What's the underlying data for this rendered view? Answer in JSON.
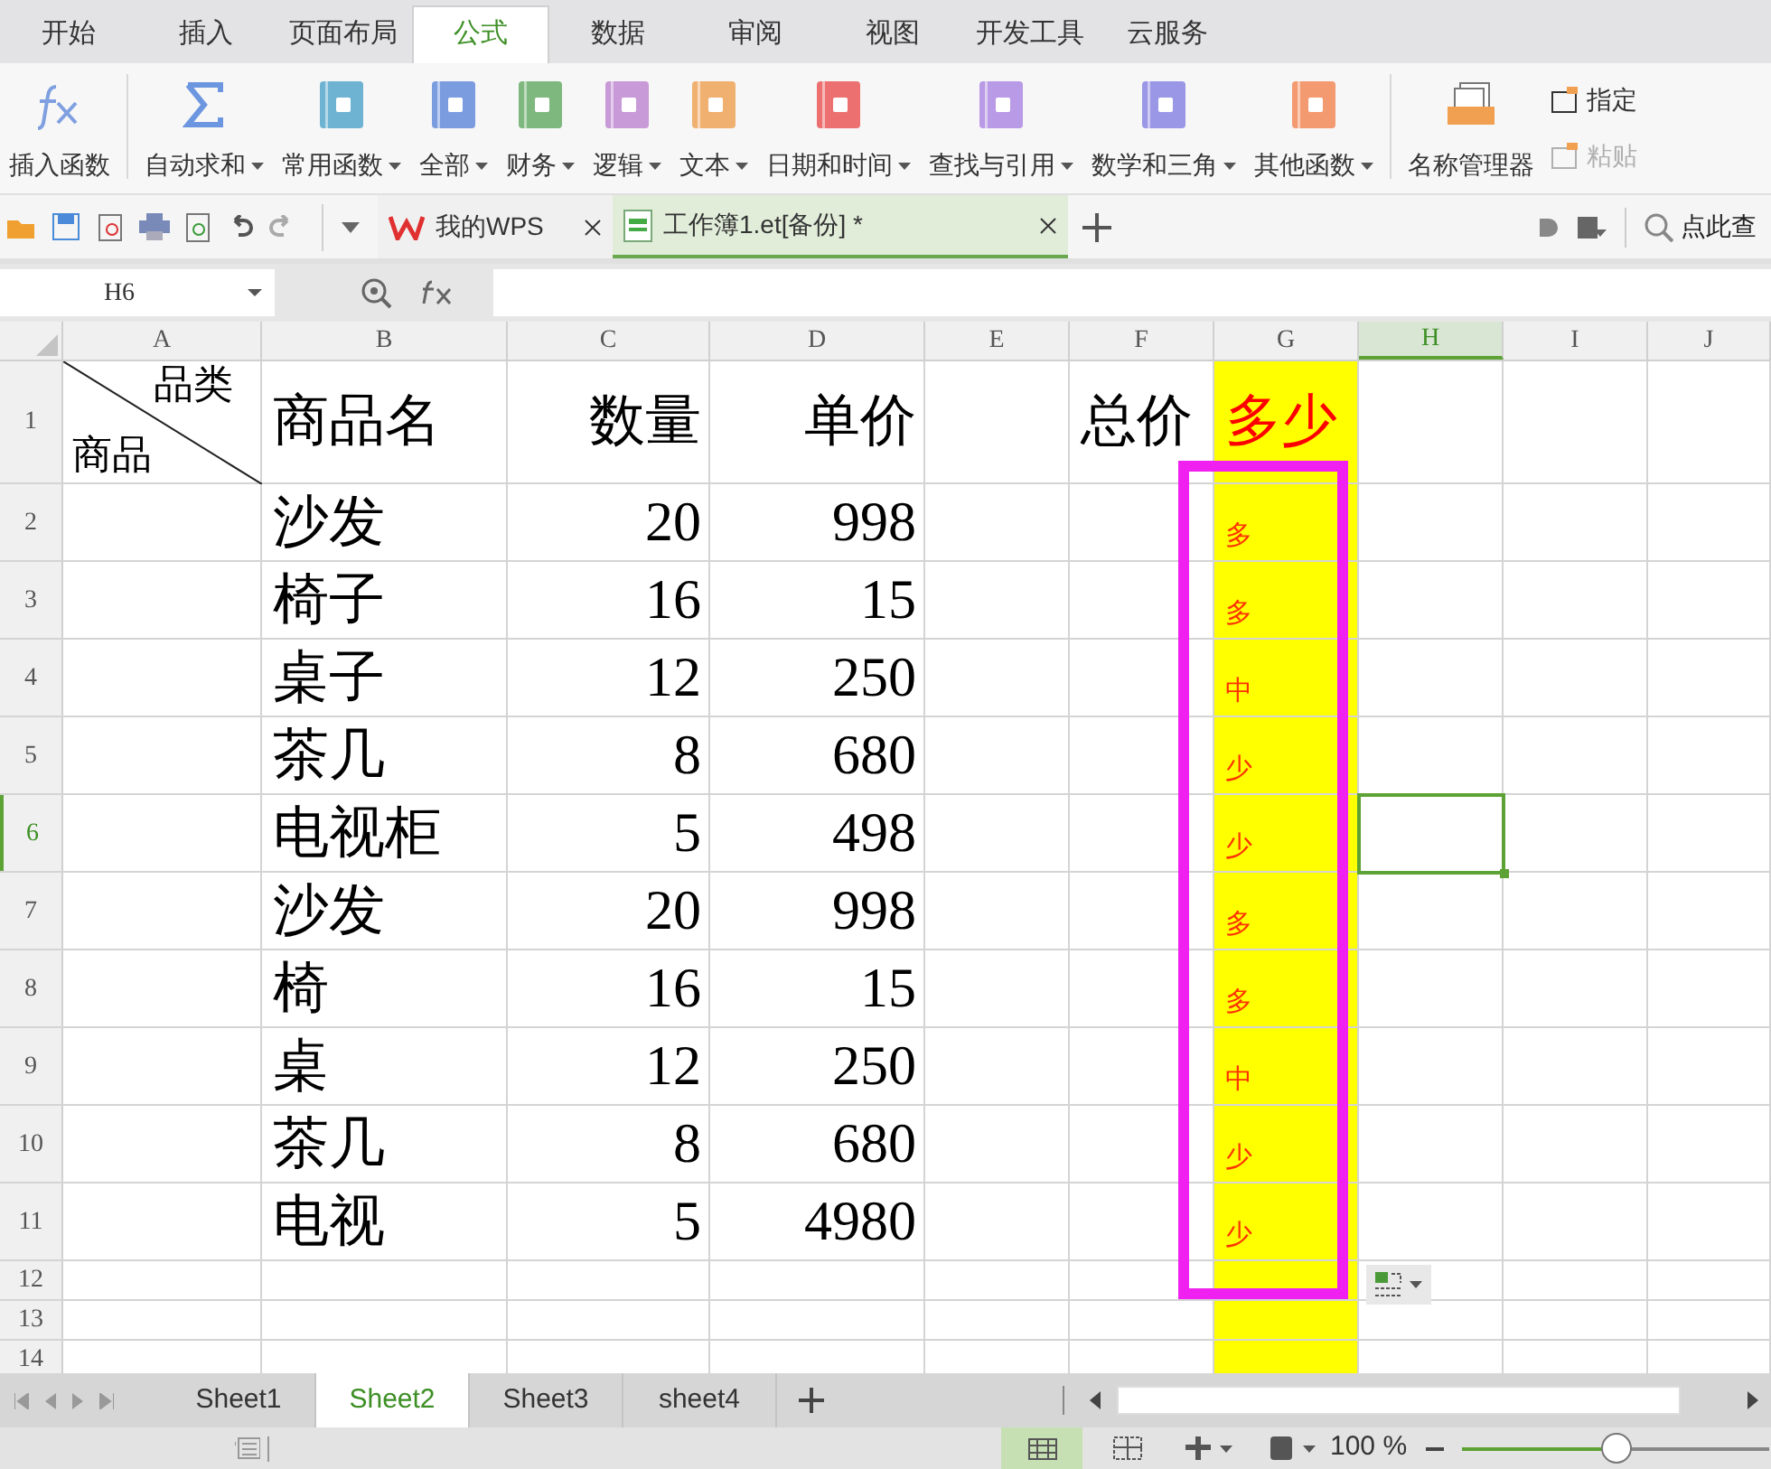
{
  "menu_tabs": [
    {
      "label": "开始",
      "selected": false
    },
    {
      "label": "插入",
      "selected": false
    },
    {
      "label": "页面布局",
      "selected": false
    },
    {
      "label": "公式",
      "selected": true
    },
    {
      "label": "数据",
      "selected": false
    },
    {
      "label": "审阅",
      "selected": false
    },
    {
      "label": "视图",
      "selected": false
    },
    {
      "label": "开发工具",
      "selected": false
    },
    {
      "label": "云服务",
      "selected": false
    }
  ],
  "ribbon": {
    "groups": [
      {
        "items": [
          {
            "kind": "fx",
            "label": "插入函数",
            "dropdown": false
          }
        ]
      },
      {
        "items": [
          {
            "kind": "sigma",
            "label": "自动求和",
            "dropdown": true
          },
          {
            "kind": "book",
            "label": "常用函数",
            "dropdown": true,
            "color": "#6fb3d2"
          },
          {
            "kind": "book",
            "label": "全部",
            "dropdown": true,
            "color": "#7b9de0"
          },
          {
            "kind": "book",
            "label": "财务",
            "dropdown": true,
            "color": "#7fb87f"
          },
          {
            "kind": "book",
            "label": "逻辑",
            "dropdown": true,
            "color": "#c89ad8"
          },
          {
            "kind": "book",
            "label": "文本",
            "dropdown": true,
            "color": "#f0b070"
          },
          {
            "kind": "book",
            "label": "日期和时间",
            "dropdown": true,
            "color": "#ec7070"
          },
          {
            "kind": "book",
            "label": "查找与引用",
            "dropdown": true,
            "color": "#b99ae6"
          },
          {
            "kind": "book",
            "label": "数学和三角",
            "dropdown": true,
            "color": "#9a97e6"
          },
          {
            "kind": "book",
            "label": "其他函数",
            "dropdown": true,
            "color": "#f49a70"
          }
        ]
      },
      {
        "items": [
          {
            "kind": "names",
            "label": "名称管理器",
            "dropdown": false
          }
        ],
        "small_items": [
          {
            "label": "指定",
            "disabled": false
          },
          {
            "label": "粘贴",
            "disabled": true
          }
        ]
      }
    ]
  },
  "doc_tabs": [
    {
      "kind": "home",
      "label": "我的WPS",
      "selected": false
    },
    {
      "kind": "workbook",
      "label": "工作簿1.et[备份] *",
      "selected": true
    }
  ],
  "search": {
    "placeholder": "点此查"
  },
  "formula_bar": {
    "name_box": "H6"
  },
  "sheet": {
    "columns": [
      {
        "label": "A",
        "selected": false,
        "highlighted": false
      },
      {
        "label": "B",
        "selected": false,
        "highlighted": false
      },
      {
        "label": "C",
        "selected": false,
        "highlighted": false
      },
      {
        "label": "D",
        "selected": false,
        "highlighted": false
      },
      {
        "label": "E",
        "selected": false,
        "highlighted": false
      },
      {
        "label": "F",
        "selected": false,
        "highlighted": false
      },
      {
        "label": "G",
        "selected": false,
        "highlighted": true
      },
      {
        "label": "H",
        "selected": true,
        "highlighted": false
      },
      {
        "label": "I",
        "selected": false,
        "highlighted": false
      },
      {
        "label": "J",
        "selected": false,
        "highlighted": false
      }
    ],
    "rows": [
      {
        "kind": "header",
        "label": "1",
        "selected": false,
        "category": "品类",
        "item": "商品",
        "name": "商品名",
        "quantity": "数量",
        "price": "单价",
        "total": "总价",
        "amount": "多少"
      },
      {
        "kind": "data",
        "label": "2",
        "selected": false,
        "name": "沙发",
        "quantity": "20",
        "price": "998",
        "amount": "多"
      },
      {
        "kind": "data",
        "label": "3",
        "selected": false,
        "name": "椅子",
        "quantity": "16",
        "price": "15",
        "amount": "多"
      },
      {
        "kind": "data",
        "label": "4",
        "selected": false,
        "name": "桌子",
        "quantity": "12",
        "price": "250",
        "amount": "中"
      },
      {
        "kind": "data",
        "label": "5",
        "selected": false,
        "name": "茶几",
        "quantity": "8",
        "price": "680",
        "amount": "少"
      },
      {
        "kind": "data",
        "label": "6",
        "selected": true,
        "name": "电视柜",
        "quantity": "5",
        "price": "498",
        "amount": "少"
      },
      {
        "kind": "data",
        "label": "7",
        "selected": false,
        "name": "沙发",
        "quantity": "20",
        "price": "998",
        "amount": "多"
      },
      {
        "kind": "data",
        "label": "8",
        "selected": false,
        "name": "椅",
        "quantity": "16",
        "price": "15",
        "amount": "多"
      },
      {
        "kind": "data",
        "label": "9",
        "selected": false,
        "name": "桌",
        "quantity": "12",
        "price": "250",
        "amount": "中"
      },
      {
        "kind": "data",
        "label": "10",
        "selected": false,
        "name": "茶几",
        "quantity": "8",
        "price": "680",
        "amount": "少"
      },
      {
        "kind": "data",
        "label": "11",
        "selected": false,
        "name": "电视",
        "quantity": "5",
        "price": "4980",
        "amount": "少"
      },
      {
        "kind": "empty",
        "label": "12",
        "selected": false
      },
      {
        "kind": "empty",
        "label": "13",
        "selected": false
      },
      {
        "kind": "empty",
        "label": "14",
        "selected": false
      }
    ]
  },
  "sheet_tabs": [
    {
      "label": "Sheet1",
      "selected": false
    },
    {
      "label": "Sheet2",
      "selected": true
    },
    {
      "label": "Sheet3",
      "selected": false
    },
    {
      "label": "sheet4",
      "selected": false
    }
  ],
  "status_bar": {
    "zoom": "100 %",
    "zoom_slider": {
      "level": 0.5
    }
  }
}
